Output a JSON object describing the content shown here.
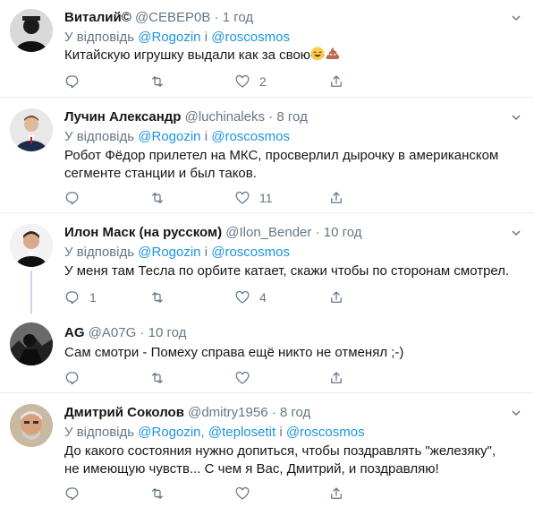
{
  "reply_prefix": "У відповідь",
  "and_word": "і",
  "tweets": [
    {
      "name": "Виталий©",
      "handle": "@CEBEP0B",
      "dot": "·",
      "time": "1 год",
      "mentions": [
        "@Rogozin",
        "@roscosmos"
      ],
      "text": "Китайскую игрушку выдали как за свою",
      "emojis": [
        "laughing-tears-icon",
        "poop-icon"
      ],
      "reply_count": "",
      "retweet_count": "",
      "like_count": "2"
    },
    {
      "name": "Лучин Александр",
      "handle": "@luchinaleks",
      "dot": "·",
      "time": "8 год",
      "mentions": [
        "@Rogozin",
        "@roscosmos"
      ],
      "text": "Робот Фёдор прилетел на МКС, просверлил дырочку в американском сегменте станции и был таков.",
      "reply_count": "",
      "retweet_count": "",
      "like_count": "11"
    },
    {
      "name": "Илон Маск (на русском)",
      "handle": "@Ilon_Bender",
      "dot": "·",
      "time": "10 год",
      "mentions": [
        "@Rogozin",
        "@roscosmos"
      ],
      "text": "У меня там Тесла по орбите катает, скажи чтобы по сторонам смотрел.",
      "reply_count": "1",
      "retweet_count": "",
      "like_count": "4"
    },
    {
      "name": "AG",
      "handle": "@A07G",
      "dot": "·",
      "time": "10 год",
      "text": "Сам смотри - Помеху справа ещё никто не отменял ;-)",
      "reply_count": "",
      "retweet_count": "",
      "like_count": ""
    },
    {
      "name": "Дмитрий Соколов",
      "handle": "@dmitry1956",
      "dot": "·",
      "time": "8 год",
      "mentions": [
        "@Rogozin",
        "@teplosetit",
        "@roscosmos"
      ],
      "mention_sep": ",",
      "text": "До какого состояния нужно допиться, чтобы поздравлять \"железяку\", не имеющую чувств... С чем я Вас, Дмитрий, и поздравляю!",
      "reply_count": "",
      "retweet_count": "",
      "like_count": ""
    }
  ],
  "colors": {
    "link": "#1b95e0",
    "muted": "#657786",
    "separator": "#e6ecf0"
  }
}
